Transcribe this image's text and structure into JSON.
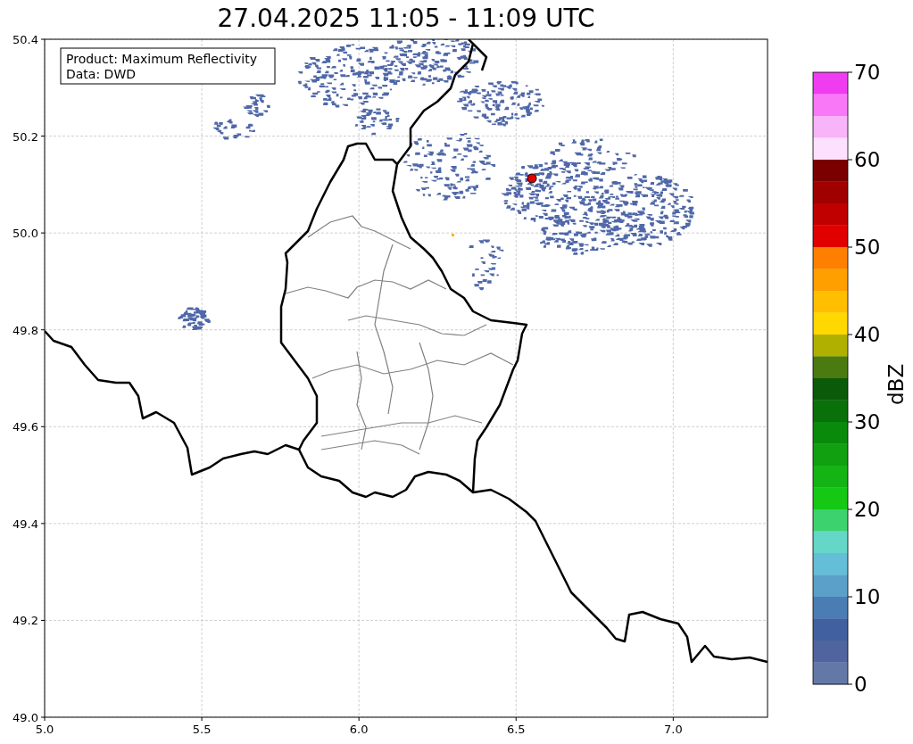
{
  "title": "27.04.2025 11:05 - 11:09 UTC",
  "map": {
    "info_box": [
      "Product: Maximum Reflectivity",
      "Data: DWD"
    ],
    "x_ticks": [
      "5.0",
      "5.5",
      "6.0",
      "6.5",
      "7.0"
    ],
    "y_ticks": [
      "50.4",
      "50.2",
      "50.0",
      "49.8",
      "49.6",
      "49.4",
      "49.2",
      "49.0"
    ]
  },
  "colorbar": {
    "label": "dBZ",
    "ticks": [
      "70",
      "60",
      "50",
      "40",
      "30",
      "20",
      "10",
      "0"
    ],
    "bins": [
      {
        "color": "#f03cf0"
      },
      {
        "color": "#f878f8"
      },
      {
        "color": "#f8b4f8"
      },
      {
        "color": "#fde0fd"
      },
      {
        "color": "#7a0000"
      },
      {
        "color": "#a00000"
      },
      {
        "color": "#c00000"
      },
      {
        "color": "#e00000"
      },
      {
        "color": "#ff7f00"
      },
      {
        "color": "#ff9f00"
      },
      {
        "color": "#ffbf00"
      },
      {
        "color": "#ffd800"
      },
      {
        "color": "#b0b000"
      },
      {
        "color": "#4a7a10"
      },
      {
        "color": "#0a5a0a"
      },
      {
        "color": "#0a700a"
      },
      {
        "color": "#0a8a0a"
      },
      {
        "color": "#10a010"
      },
      {
        "color": "#14b414"
      },
      {
        "color": "#14c814"
      },
      {
        "color": "#3cd26e"
      },
      {
        "color": "#64d7c8"
      },
      {
        "color": "#64bed7"
      },
      {
        "color": "#5aa0c8"
      },
      {
        "color": "#4b7db4"
      },
      {
        "color": "#4160a0"
      },
      {
        "color": "#5064a0"
      },
      {
        "color": "#6478a8"
      }
    ]
  }
}
